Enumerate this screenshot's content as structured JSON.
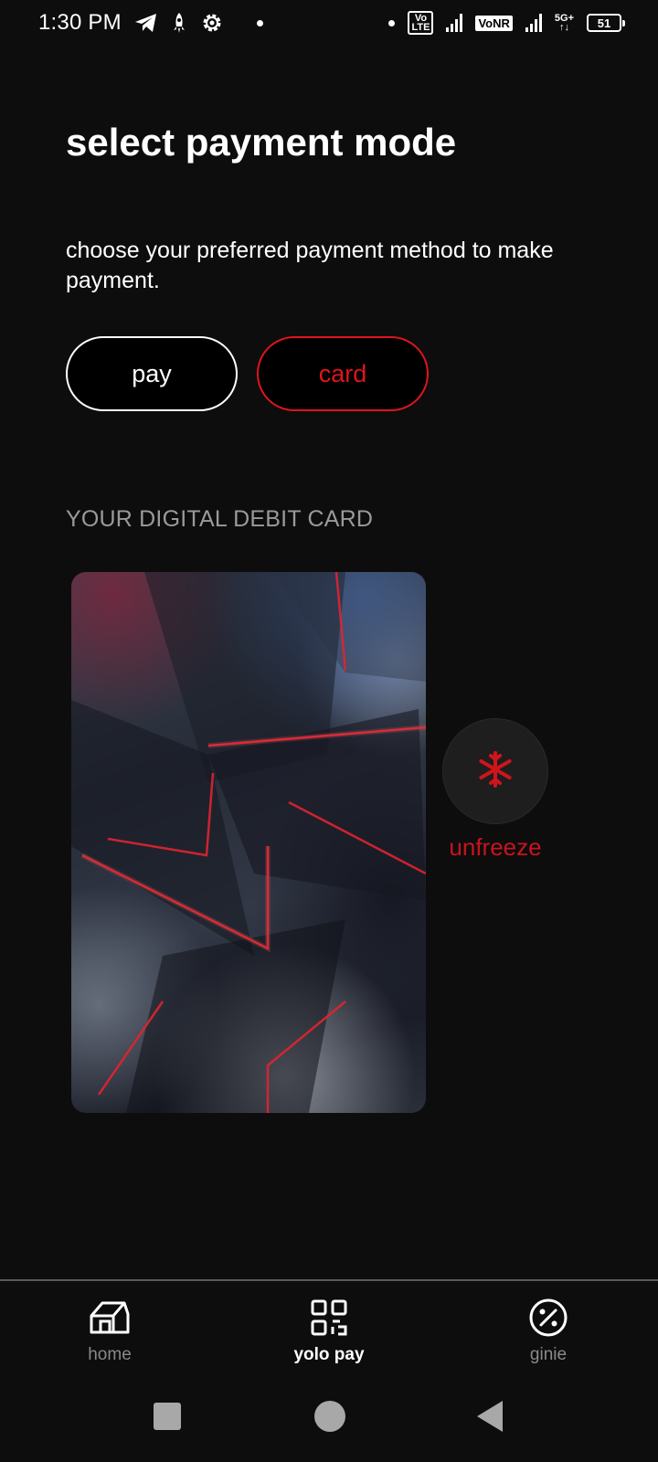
{
  "status_bar": {
    "time": "1:30 PM",
    "volte_badge": "Vo\nLTE",
    "vonr_badge": "VoNR",
    "net_badge": "5G+",
    "battery": "51",
    "icons": [
      "telegram-icon",
      "rocket-icon",
      "gear-icon",
      "dot-icon",
      "dot-icon",
      "volte-icon",
      "signal-icon",
      "vonr-icon",
      "signal-icon",
      "5g-icon",
      "battery-icon"
    ]
  },
  "header": {
    "title": "select payment mode",
    "subtitle": "choose your preferred payment method to make payment."
  },
  "mode_toggle": {
    "pay_label": "pay",
    "card_label": "card",
    "selected": "card"
  },
  "card_section": {
    "label": "YOUR DIGITAL DEBIT CARD",
    "freeze_icon": "snowflake-icon",
    "freeze_label": "unfreeze"
  },
  "bottom_nav": {
    "items": [
      {
        "label": "home",
        "icon": "home-icon",
        "active": false
      },
      {
        "label": "yolo pay",
        "icon": "qr-code-icon",
        "active": true
      },
      {
        "label": "ginie",
        "icon": "percent-icon",
        "active": false
      }
    ]
  },
  "colors": {
    "background": "#0d0d0d",
    "accent_red": "#e0141c",
    "muted_text": "#9a9a9a"
  }
}
